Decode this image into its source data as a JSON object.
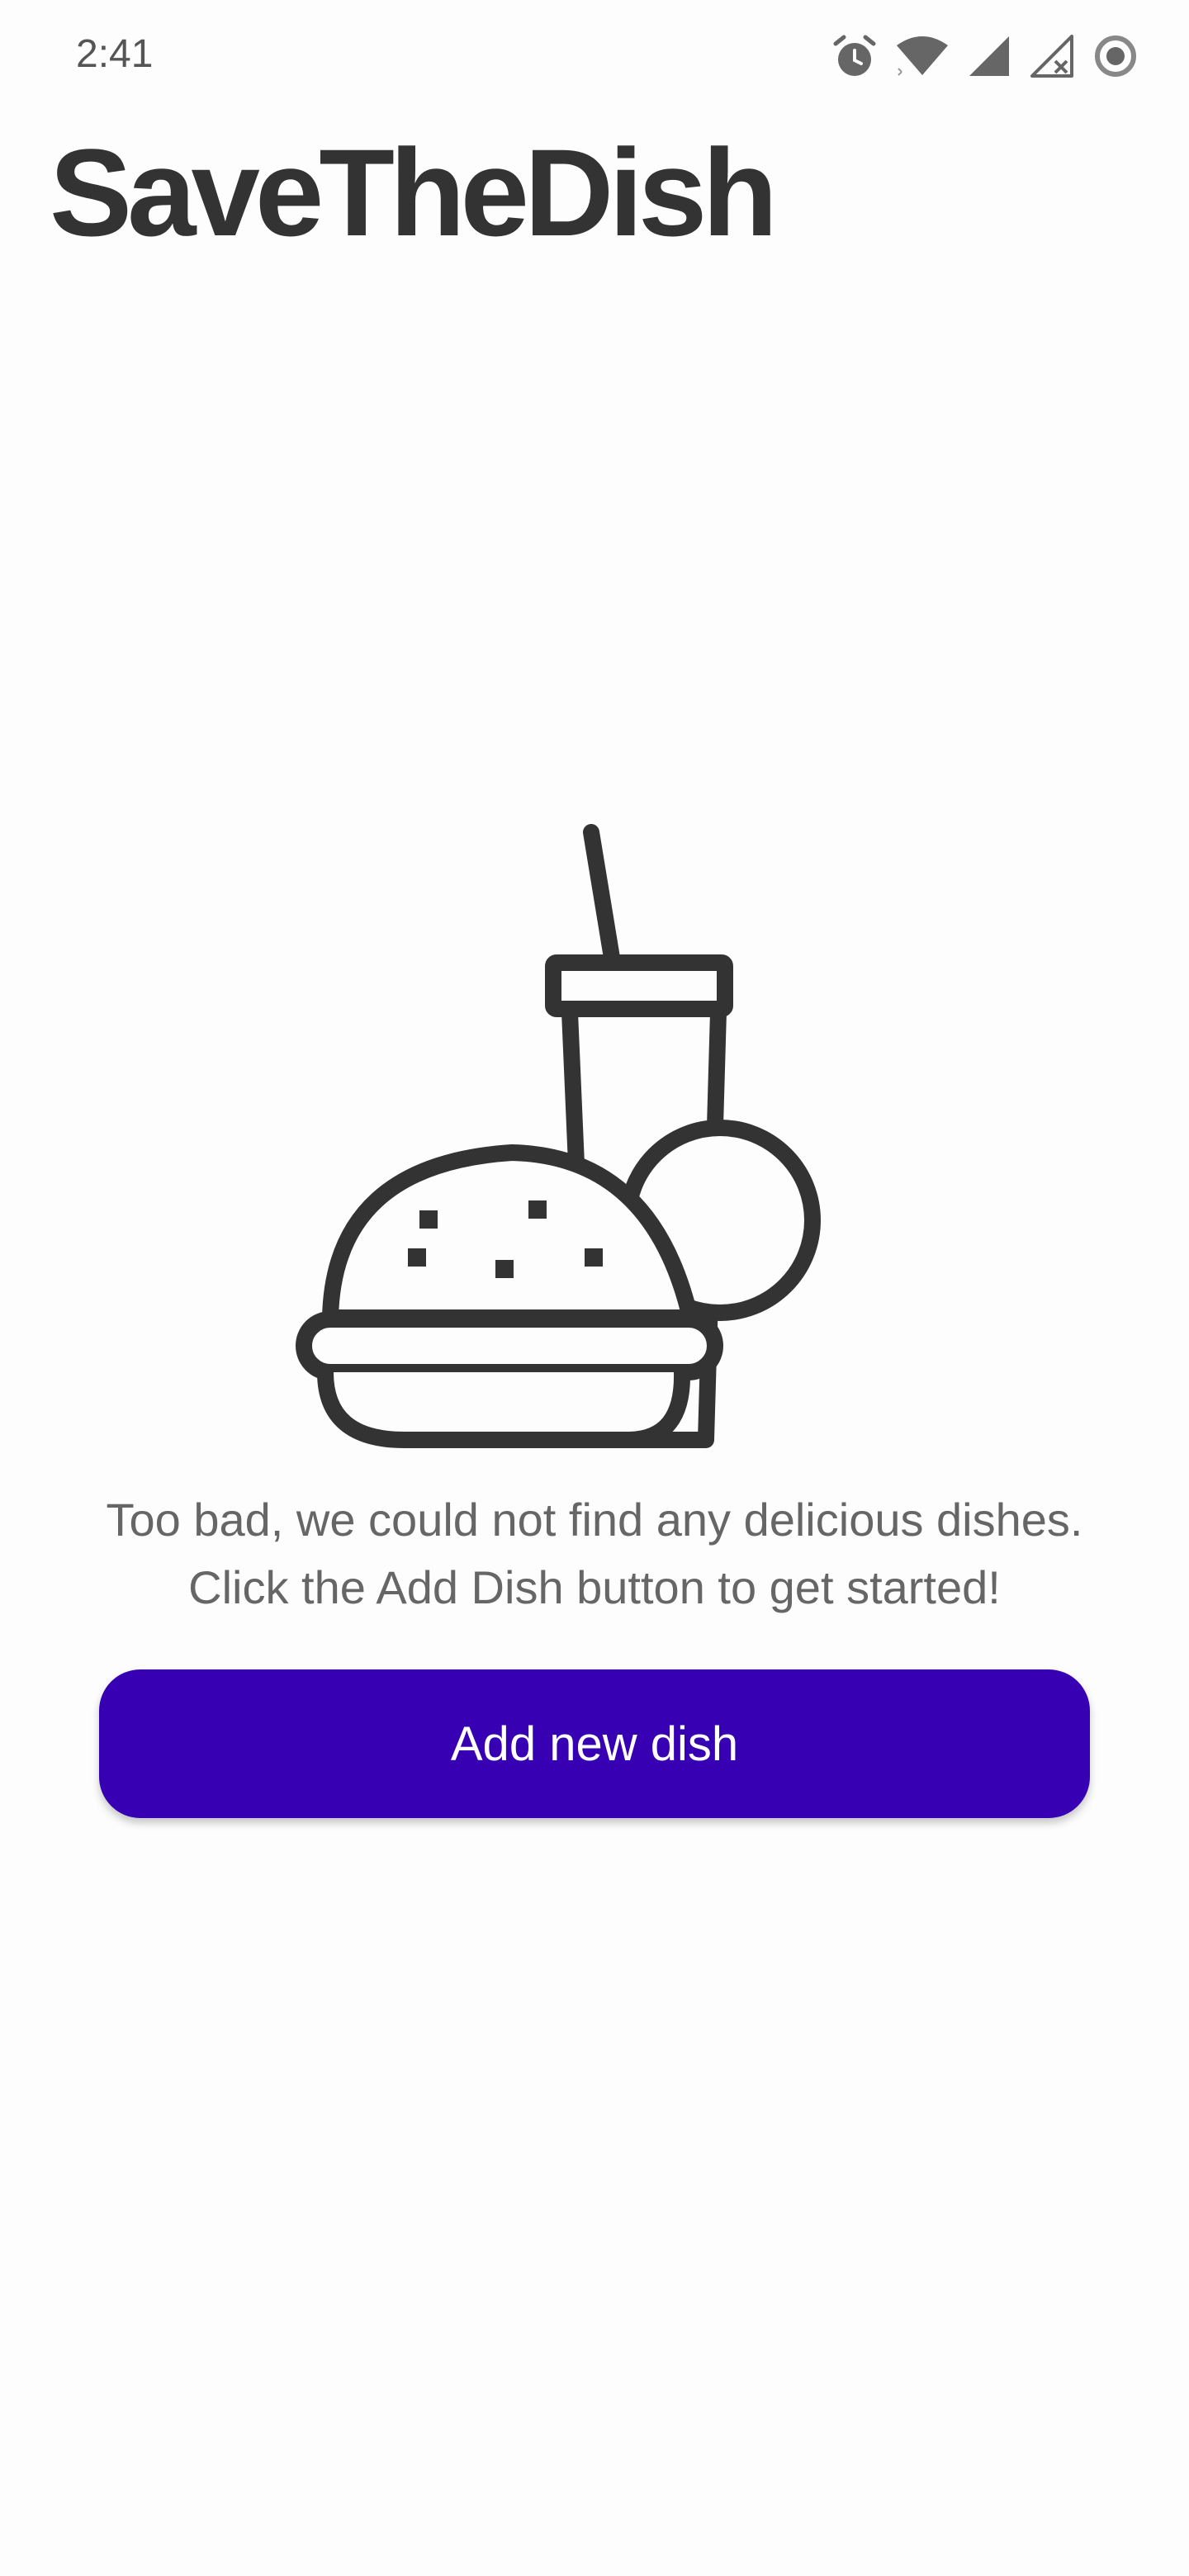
{
  "status_bar": {
    "time": "2:41",
    "icons": [
      "alarm-icon",
      "wifi-icon",
      "cell-signal-icon",
      "no-signal-icon",
      "sync-icon"
    ]
  },
  "header": {
    "title": "SaveTheDish"
  },
  "empty_state": {
    "illustration": "burger-and-drink-icon",
    "message_line1": "Too bad, we could not find any delicious dishes.",
    "message_line2": "Click the Add Dish button to get started!"
  },
  "actions": {
    "add_button_label": "Add new dish"
  },
  "colors": {
    "accent": "#3700b3",
    "text_primary": "#333333",
    "text_secondary": "#666666",
    "background": "#fdfdfd"
  }
}
